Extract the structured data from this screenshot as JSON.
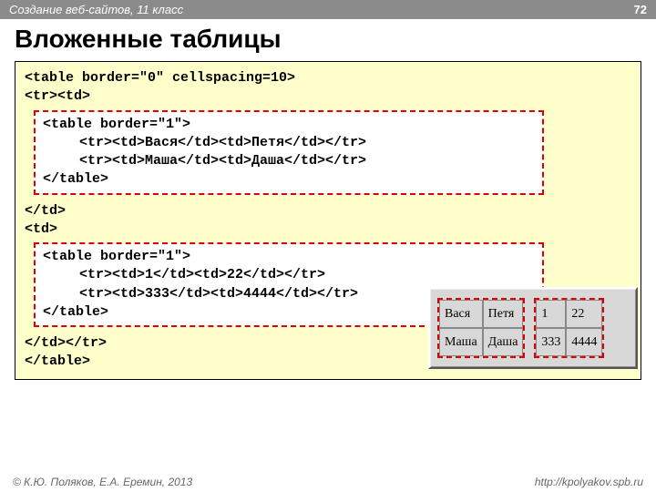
{
  "header": {
    "course": "Создание веб-сайтов, 11 класс",
    "page": "72"
  },
  "title": "Вложенные таблицы",
  "code": {
    "outer_open1": "<table border=\"0\" cellspacing=10>",
    "outer_open2": "<tr><td>",
    "inner1": {
      "l1": "<table border=\"1\">",
      "l2": "<tr><td>Вася</td><td>Петя</td></tr>",
      "l3": "<tr><td>Маша</td><td>Даша</td></tr>",
      "l4": "</table>"
    },
    "mid1": "</td>",
    "mid2": "<td>",
    "inner2": {
      "l1": "<table border=\"1\">",
      "l2": "<tr><td>1</td><td>22</td></tr>",
      "l3": "<tr><td>333</td><td>4444</td></tr>",
      "l4": "</table>"
    },
    "outer_close1": "</td></tr>",
    "outer_close2": "</table>"
  },
  "preview": {
    "t1": {
      "r1c1": "Вася",
      "r1c2": "Петя",
      "r2c1": "Маша",
      "r2c2": "Даша"
    },
    "t2": {
      "r1c1": "1",
      "r1c2": "22",
      "r2c1": "333",
      "r2c2": "4444"
    }
  },
  "footer": {
    "left": "© К.Ю. Поляков, Е.А. Еремин, 2013",
    "right": "http://kpolyakov.spb.ru"
  }
}
